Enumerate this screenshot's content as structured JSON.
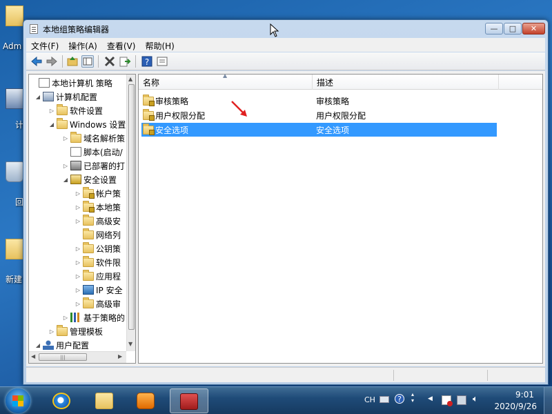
{
  "desktop": {
    "icons": [
      {
        "label": "Adm"
      },
      {
        "label": "计"
      },
      {
        "label": "回"
      },
      {
        "label": "新建"
      }
    ]
  },
  "window": {
    "title": "本地组策略编辑器",
    "buttons": {
      "minimize": "—",
      "maximize": "□",
      "close": "✕"
    }
  },
  "menubar": [
    "文件(F)",
    "操作(A)",
    "查看(V)",
    "帮助(H)"
  ],
  "toolbar": [
    "back-icon",
    "forward-icon",
    "up-icon",
    "show-hide-tree-icon",
    "delete-icon",
    "export-icon",
    "help-icon",
    "properties-icon"
  ],
  "tree": [
    {
      "label": "本地计算机 策略",
      "icon": "policy-icon",
      "arrow": ""
    },
    {
      "label": "计算机配置",
      "icon": "computer-icon",
      "arrow": "◢"
    },
    {
      "label": "软件设置",
      "icon": "folder-icon",
      "arrow": "▷"
    },
    {
      "label": "Windows 设置",
      "icon": "folder-icon",
      "arrow": "◢"
    },
    {
      "label": "域名解析策",
      "icon": "folder-icon",
      "arrow": "▷"
    },
    {
      "label": "脚本(启动/",
      "icon": "script-icon",
      "arrow": ""
    },
    {
      "label": "已部署的打",
      "icon": "printer-icon",
      "arrow": "▷"
    },
    {
      "label": "安全设置",
      "icon": "shield-icon",
      "arrow": "◢"
    },
    {
      "label": "帐户策",
      "icon": "folder-lock-icon",
      "arrow": "▷"
    },
    {
      "label": "本地策",
      "icon": "folder-lock-icon",
      "arrow": "▷"
    },
    {
      "label": "高级安",
      "icon": "folder-icon",
      "arrow": "▷"
    },
    {
      "label": "网络列",
      "icon": "folder-icon",
      "arrow": ""
    },
    {
      "label": "公钥策",
      "icon": "folder-icon",
      "arrow": "▷"
    },
    {
      "label": "软件限",
      "icon": "folder-icon",
      "arrow": "▷"
    },
    {
      "label": "应用程",
      "icon": "folder-icon",
      "arrow": "▷"
    },
    {
      "label": "IP 安全",
      "icon": "network-icon",
      "arrow": "▷"
    },
    {
      "label": "高级审",
      "icon": "folder-icon",
      "arrow": "▷"
    },
    {
      "label": "基于策略的",
      "icon": "chart-icon",
      "arrow": "▷"
    },
    {
      "label": "管理模板",
      "icon": "folder-icon",
      "arrow": "▷"
    },
    {
      "label": "用户配置",
      "icon": "user-icon",
      "arrow": "◢"
    }
  ],
  "tree_hscroll_label": "|||",
  "list": {
    "columns": [
      "名称",
      "描述"
    ],
    "rows": [
      {
        "name": "审核策略",
        "desc": "审核策略",
        "selected": false
      },
      {
        "name": "用户权限分配",
        "desc": "用户权限分配",
        "selected": false
      },
      {
        "name": "安全选项",
        "desc": "安全选项",
        "selected": true
      }
    ]
  },
  "taskbar": {
    "apps": [
      "ie-icon",
      "explorer-icon",
      "media-player-icon",
      "group-policy-icon"
    ],
    "tray": {
      "lang": "CH",
      "time": "9:01",
      "date": "2020/9/26"
    }
  },
  "colors": {
    "selection": "#3399ff",
    "annotation_arrow": "#e02020"
  }
}
